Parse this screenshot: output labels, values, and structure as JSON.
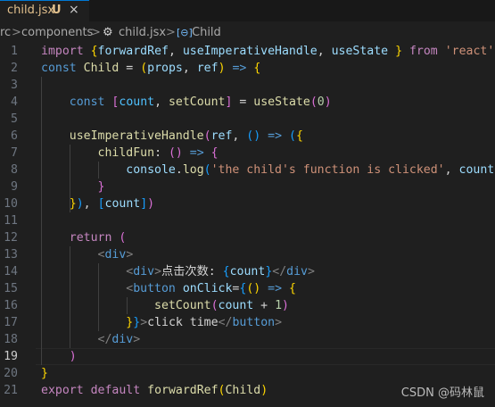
{
  "tab": {
    "filename": "child.jsx",
    "status": "U",
    "close": "×"
  },
  "breadcrumb": {
    "parts": [
      "rc",
      "components",
      "child.jsx",
      "Child"
    ],
    "separator": ">"
  },
  "editor": {
    "active_line": 19,
    "lines": [
      {
        "n": "1",
        "tokens": [
          [
            "kw",
            "import"
          ],
          [
            "txt",
            " "
          ],
          [
            "br1",
            "{"
          ],
          [
            "vr",
            "forwardRef"
          ],
          [
            "txt",
            ", "
          ],
          [
            "vr",
            "useImperativeHandle"
          ],
          [
            "txt",
            ", "
          ],
          [
            "vr",
            "useState"
          ],
          [
            "txt",
            " "
          ],
          [
            "br1",
            "}"
          ],
          [
            "txt",
            " "
          ],
          [
            "kw",
            "from"
          ],
          [
            "txt",
            " "
          ],
          [
            "str",
            "'react'"
          ]
        ]
      },
      {
        "n": "2",
        "tokens": [
          [
            "kw2",
            "const"
          ],
          [
            "txt",
            " "
          ],
          [
            "fn",
            "Child"
          ],
          [
            "txt",
            " = "
          ],
          [
            "br1",
            "("
          ],
          [
            "vr",
            "props"
          ],
          [
            "txt",
            ", "
          ],
          [
            "vr",
            "ref"
          ],
          [
            "br1",
            ")"
          ],
          [
            "txt",
            " "
          ],
          [
            "kw2",
            "=>"
          ],
          [
            "txt",
            " "
          ],
          [
            "br1",
            "{"
          ]
        ]
      },
      {
        "n": "3",
        "tokens": []
      },
      {
        "n": "4",
        "tokens": [
          [
            "txt",
            "    "
          ],
          [
            "kw2",
            "const"
          ],
          [
            "txt",
            " "
          ],
          [
            "br2",
            "["
          ],
          [
            "cn",
            "count"
          ],
          [
            "txt",
            ", "
          ],
          [
            "fn",
            "setCount"
          ],
          [
            "br2",
            "]"
          ],
          [
            "txt",
            " = "
          ],
          [
            "fn",
            "useState"
          ],
          [
            "br2",
            "("
          ],
          [
            "num",
            "0"
          ],
          [
            "br2",
            ")"
          ]
        ]
      },
      {
        "n": "5",
        "tokens": []
      },
      {
        "n": "6",
        "tokens": [
          [
            "txt",
            "    "
          ],
          [
            "fn",
            "useImperativeHandle"
          ],
          [
            "br2",
            "("
          ],
          [
            "vr",
            "ref"
          ],
          [
            "txt",
            ", "
          ],
          [
            "br3",
            "()"
          ],
          [
            "txt",
            " "
          ],
          [
            "kw2",
            "=>"
          ],
          [
            "txt",
            " "
          ],
          [
            "br3",
            "("
          ],
          [
            "br1",
            "{"
          ]
        ]
      },
      {
        "n": "7",
        "tokens": [
          [
            "txt",
            "        "
          ],
          [
            "fn",
            "childFun"
          ],
          [
            "txt",
            ": "
          ],
          [
            "br2",
            "()"
          ],
          [
            "txt",
            " "
          ],
          [
            "kw2",
            "=>"
          ],
          [
            "txt",
            " "
          ],
          [
            "br2",
            "{"
          ]
        ]
      },
      {
        "n": "8",
        "tokens": [
          [
            "txt",
            "            "
          ],
          [
            "vr",
            "console"
          ],
          [
            "txt",
            "."
          ],
          [
            "fn",
            "log"
          ],
          [
            "br3",
            "("
          ],
          [
            "str",
            "'the child's function is clicked'"
          ],
          [
            "txt",
            ", "
          ],
          [
            "vr",
            "count"
          ],
          [
            "br3",
            ")"
          ]
        ]
      },
      {
        "n": "9",
        "tokens": [
          [
            "txt",
            "        "
          ],
          [
            "br2",
            "}"
          ]
        ]
      },
      {
        "n": "10",
        "tokens": [
          [
            "txt",
            "    "
          ],
          [
            "br1",
            "}"
          ],
          [
            "br3",
            ")"
          ],
          [
            "txt",
            ", "
          ],
          [
            "br3",
            "["
          ],
          [
            "vr",
            "count"
          ],
          [
            "br3",
            "]"
          ],
          [
            "br2",
            ")"
          ]
        ]
      },
      {
        "n": "11",
        "tokens": []
      },
      {
        "n": "12",
        "tokens": [
          [
            "txt",
            "    "
          ],
          [
            "kw",
            "return"
          ],
          [
            "txt",
            " "
          ],
          [
            "br2",
            "("
          ]
        ]
      },
      {
        "n": "13",
        "tokens": [
          [
            "txt",
            "        "
          ],
          [
            "punc",
            "<"
          ],
          [
            "tag",
            "div"
          ],
          [
            "punc",
            ">"
          ]
        ]
      },
      {
        "n": "14",
        "tokens": [
          [
            "txt",
            "            "
          ],
          [
            "punc",
            "<"
          ],
          [
            "tag",
            "div"
          ],
          [
            "punc",
            ">"
          ],
          [
            "txt",
            "点击次数: "
          ],
          [
            "br3",
            "{"
          ],
          [
            "vr",
            "count"
          ],
          [
            "br3",
            "}"
          ],
          [
            "punc",
            "</"
          ],
          [
            "tag",
            "div"
          ],
          [
            "punc",
            ">"
          ]
        ]
      },
      {
        "n": "15",
        "tokens": [
          [
            "txt",
            "            "
          ],
          [
            "punc",
            "<"
          ],
          [
            "tag",
            "button"
          ],
          [
            "txt",
            " "
          ],
          [
            "vr",
            "onClick"
          ],
          [
            "txt",
            "="
          ],
          [
            "br3",
            "{"
          ],
          [
            "br1",
            "()"
          ],
          [
            "txt",
            " "
          ],
          [
            "kw2",
            "=>"
          ],
          [
            "txt",
            " "
          ],
          [
            "br1",
            "{"
          ]
        ]
      },
      {
        "n": "16",
        "tokens": [
          [
            "txt",
            "                "
          ],
          [
            "fn",
            "setCount"
          ],
          [
            "br2",
            "("
          ],
          [
            "vr",
            "count"
          ],
          [
            "txt",
            " + "
          ],
          [
            "num",
            "1"
          ],
          [
            "br2",
            ")"
          ]
        ]
      },
      {
        "n": "17",
        "tokens": [
          [
            "txt",
            "            "
          ],
          [
            "br1",
            "}"
          ],
          [
            "br3",
            "}"
          ],
          [
            "punc",
            ">"
          ],
          [
            "txt",
            "click time"
          ],
          [
            "punc",
            "</"
          ],
          [
            "tag",
            "button"
          ],
          [
            "punc",
            ">"
          ]
        ]
      },
      {
        "n": "18",
        "tokens": [
          [
            "txt",
            "        "
          ],
          [
            "punc",
            "</"
          ],
          [
            "tag",
            "div"
          ],
          [
            "punc",
            ">"
          ]
        ]
      },
      {
        "n": "19",
        "tokens": [
          [
            "txt",
            "    "
          ],
          [
            "br2",
            ")"
          ]
        ]
      },
      {
        "n": "20",
        "tokens": [
          [
            "br1",
            "}"
          ]
        ]
      },
      {
        "n": "21",
        "tokens": [
          [
            "kw",
            "export"
          ],
          [
            "txt",
            " "
          ],
          [
            "kw",
            "default"
          ],
          [
            "txt",
            " "
          ],
          [
            "fn",
            "forwardRef"
          ],
          [
            "br1",
            "("
          ],
          [
            "fn",
            "Child"
          ],
          [
            "br1",
            ")"
          ]
        ]
      }
    ]
  },
  "watermark": "CSDN @码林鼠"
}
